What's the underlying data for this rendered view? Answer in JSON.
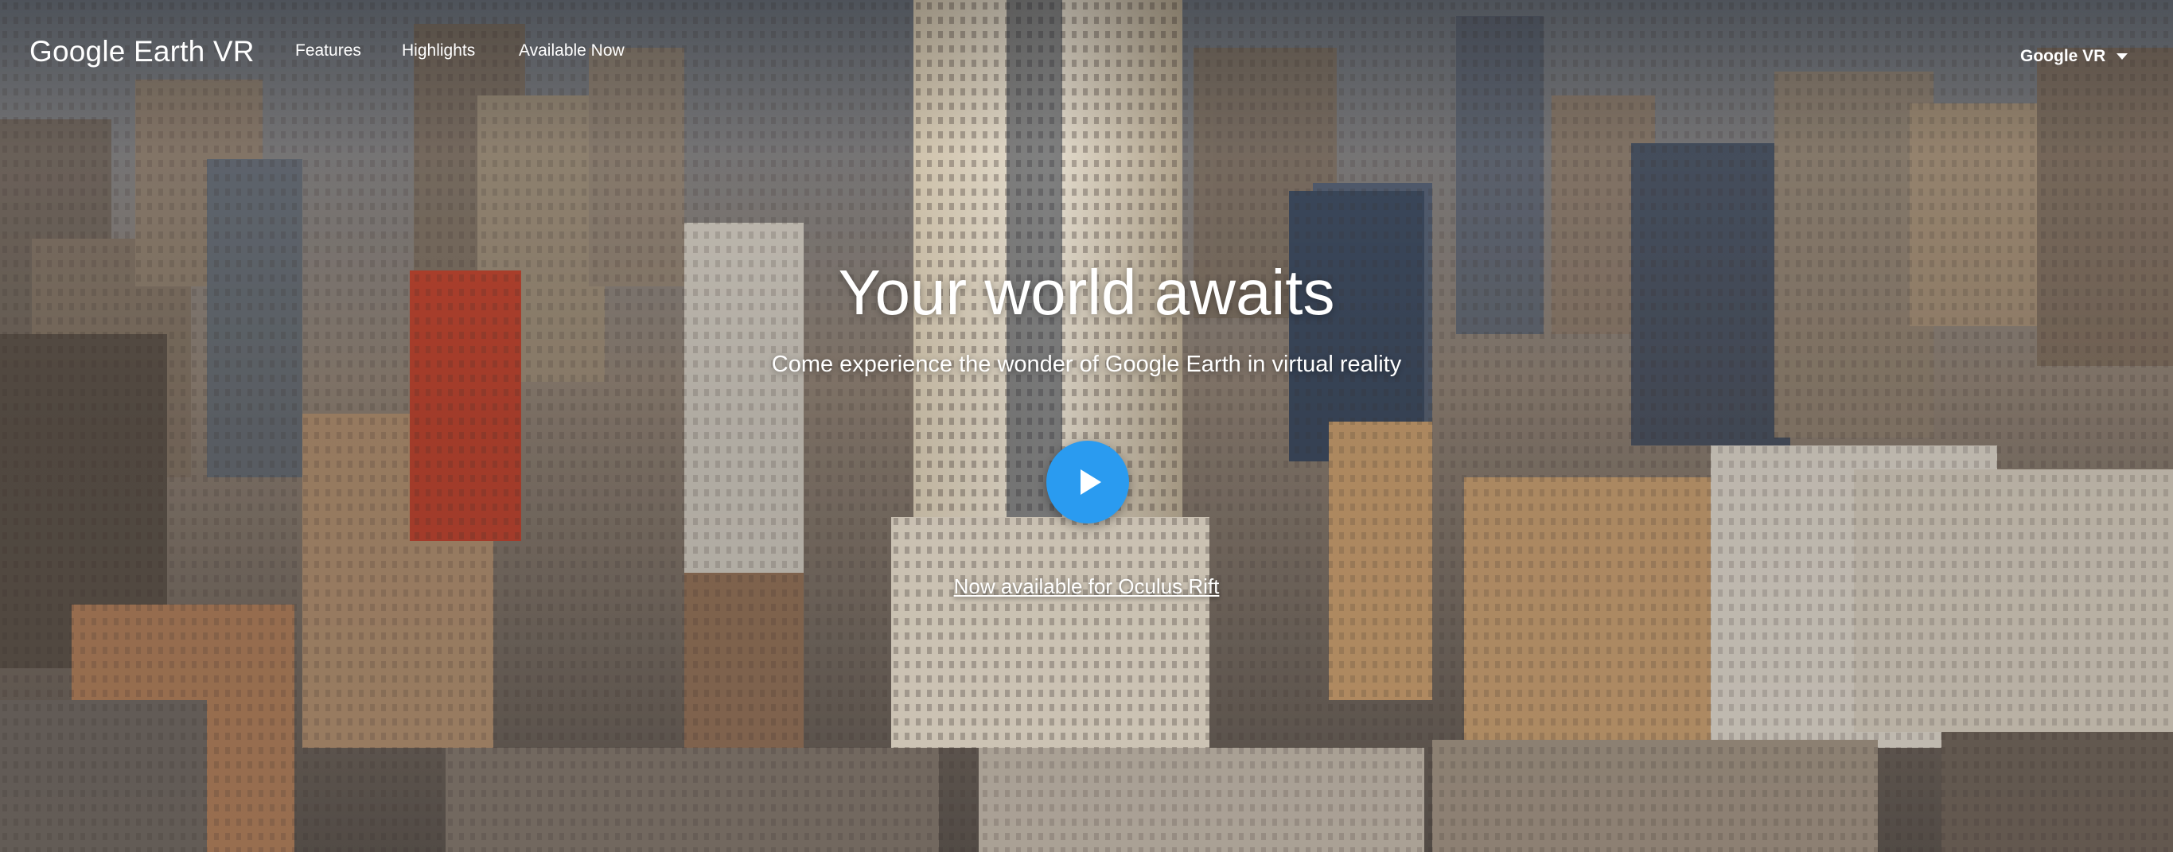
{
  "header": {
    "logo_text": "Google Earth VR",
    "nav": {
      "features": "Features",
      "highlights": "Highlights",
      "available_now": "Available Now"
    },
    "account_menu_label": "Google VR"
  },
  "hero": {
    "title": "Your world awaits",
    "subtitle": "Come experience the wonder of Google Earth in virtual reality",
    "play_icon": "play-icon",
    "availability_link": "Now available for Oculus Rift"
  },
  "colors": {
    "play_button": "#2a9bf0",
    "text": "#ffffff"
  }
}
